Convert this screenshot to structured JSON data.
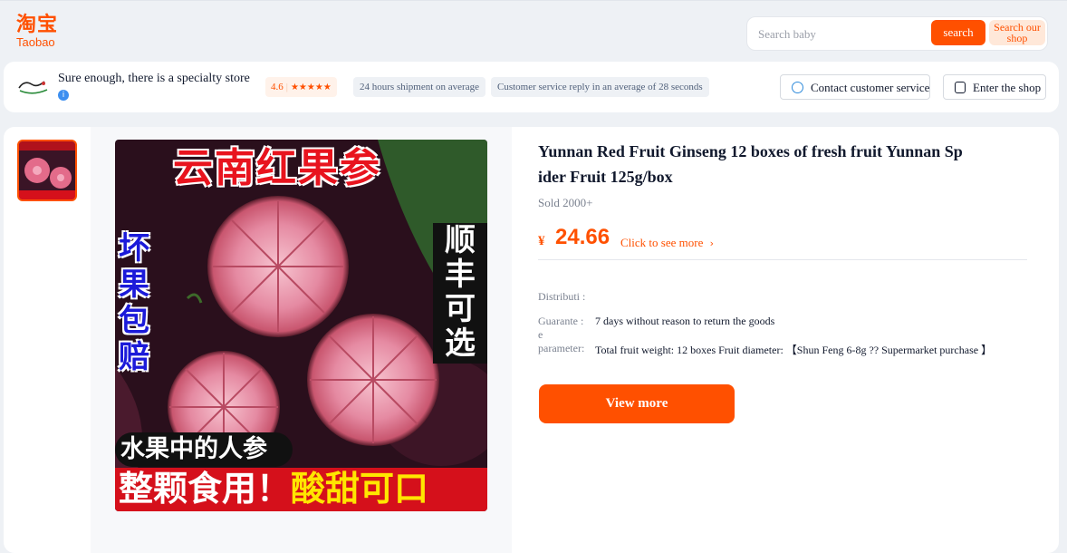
{
  "header": {
    "logo_cn": "淘宝",
    "logo_en": "Taobao",
    "search_placeholder": "Search baby",
    "search_button": "search",
    "search_shop_button": "Search our shop"
  },
  "shop": {
    "name": "Sure enough, there is a specialty store",
    "rating": "4.6",
    "stars": 4.6,
    "shipment_tag": "24 hours shipment on average",
    "reply_tag": "Customer service reply in an average of 28 seconds",
    "contact_button": "Contact customer service",
    "enter_button": "Enter the shop"
  },
  "product": {
    "title": "Yunnan Red Fruit Ginseng 12 boxes of fresh fruit Yunnan Spider Fruit 125g/box",
    "sold": "Sold 2000+",
    "currency": "¥",
    "price": "24.66",
    "see_more": "Click to see more",
    "distribution_label": "Distributi :",
    "guarantee_label": "Guarante : e",
    "guarantee_value": "7 days without reason to return the goods",
    "parameter_label": "parameter:",
    "parameter_value": "Total fruit weight: 12 boxes Fruit diameter: 【Shun Feng 6-8g ?? Supermarket purchase 】",
    "view_more_button": "View more"
  },
  "image_text": {
    "top_banner": "云南红果参",
    "left_vertical": "坏果包赔",
    "right_vertical": "顺丰可选",
    "bottom_line1": "水果中的人参",
    "bottom_line2_white": "整颗食用！",
    "bottom_line2_yellow": "酸甜可口"
  },
  "colors": {
    "accent": "#ff5000",
    "page_bg": "#eef1f5",
    "text": "#11192d"
  }
}
